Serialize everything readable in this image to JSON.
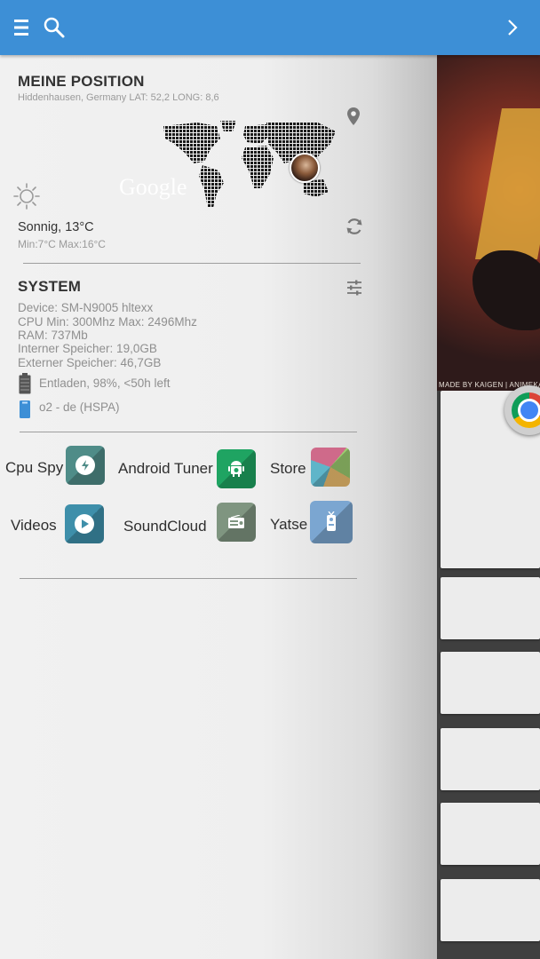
{
  "toolbar": {
    "menu_icon": "menu-icon",
    "search_icon": "search-icon",
    "next_icon": "chevron-right-icon",
    "color": "#3d8fd6"
  },
  "position": {
    "title": "MEINE POSITION",
    "location": "Hiddenhausen, Germany LAT: 52,2 LONG: 8,6",
    "map_label": "Google"
  },
  "weather": {
    "condition": "Sonnig, 13°C",
    "range": "Min:7°C Max:16°C",
    "icon": "sun-icon"
  },
  "system": {
    "title": "SYSTEM",
    "lines": [
      "Device: SM-N9005 hltexx",
      "CPU Min: 300Mhz Max: 2496Mhz",
      "RAM: 737Mb",
      "Interner Speicher: 19,0GB",
      "Externer Speicher: 46,7GB"
    ],
    "battery": "Entladen, 98%, <50h left",
    "network": "o2 - de (HSPA)"
  },
  "apps": [
    {
      "label": "Cpu Spy",
      "icon": "cpu-spy-icon",
      "color": "#4f8c88"
    },
    {
      "label": "Android Tuner",
      "icon": "android-tuner-icon",
      "color": "#1fa462"
    },
    {
      "label": "Store",
      "icon": "store-icon",
      "color": "#cf6a8a"
    },
    {
      "label": "Videos",
      "icon": "videos-icon",
      "color": "#3e8faa"
    },
    {
      "label": "SoundCloud",
      "icon": "soundcloud-icon",
      "color": "#7f9580"
    },
    {
      "label": "Yatse",
      "icon": "yatse-icon",
      "color": "#7ba6d1"
    }
  ],
  "background": {
    "art_caption": "MADE BY KAIGEN | ANIMEKA"
  }
}
